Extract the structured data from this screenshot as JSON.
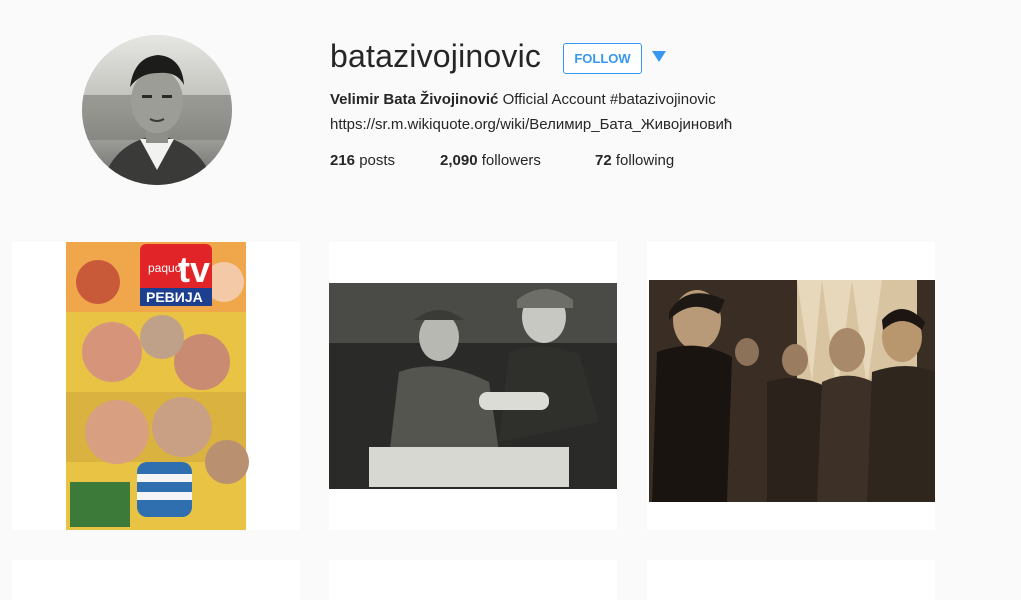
{
  "profile": {
    "username": "batazivojinovic",
    "follow_label": "FOLLOW",
    "full_name": "Velimir Bata Živojinović",
    "bio_text": " Official Account ",
    "hashtag": "#batazivojinovic",
    "link": "https://sr.m.wikiquote.org/wiki/Велимир_Бата_Живојиновић"
  },
  "stats": {
    "posts_count": "216",
    "posts_label": " posts",
    "followers_count": "2,090",
    "followers_label": " followers",
    "following_count": "72",
    "following_label": " following"
  },
  "magazine": {
    "brand_small": "paquo",
    "brand_big": "tv",
    "title": "РЕВИЈА"
  },
  "colors": {
    "accent": "#3897f0",
    "text": "#262626",
    "background": "#fafafa"
  },
  "icons": [
    "chevron-down-icon"
  ]
}
